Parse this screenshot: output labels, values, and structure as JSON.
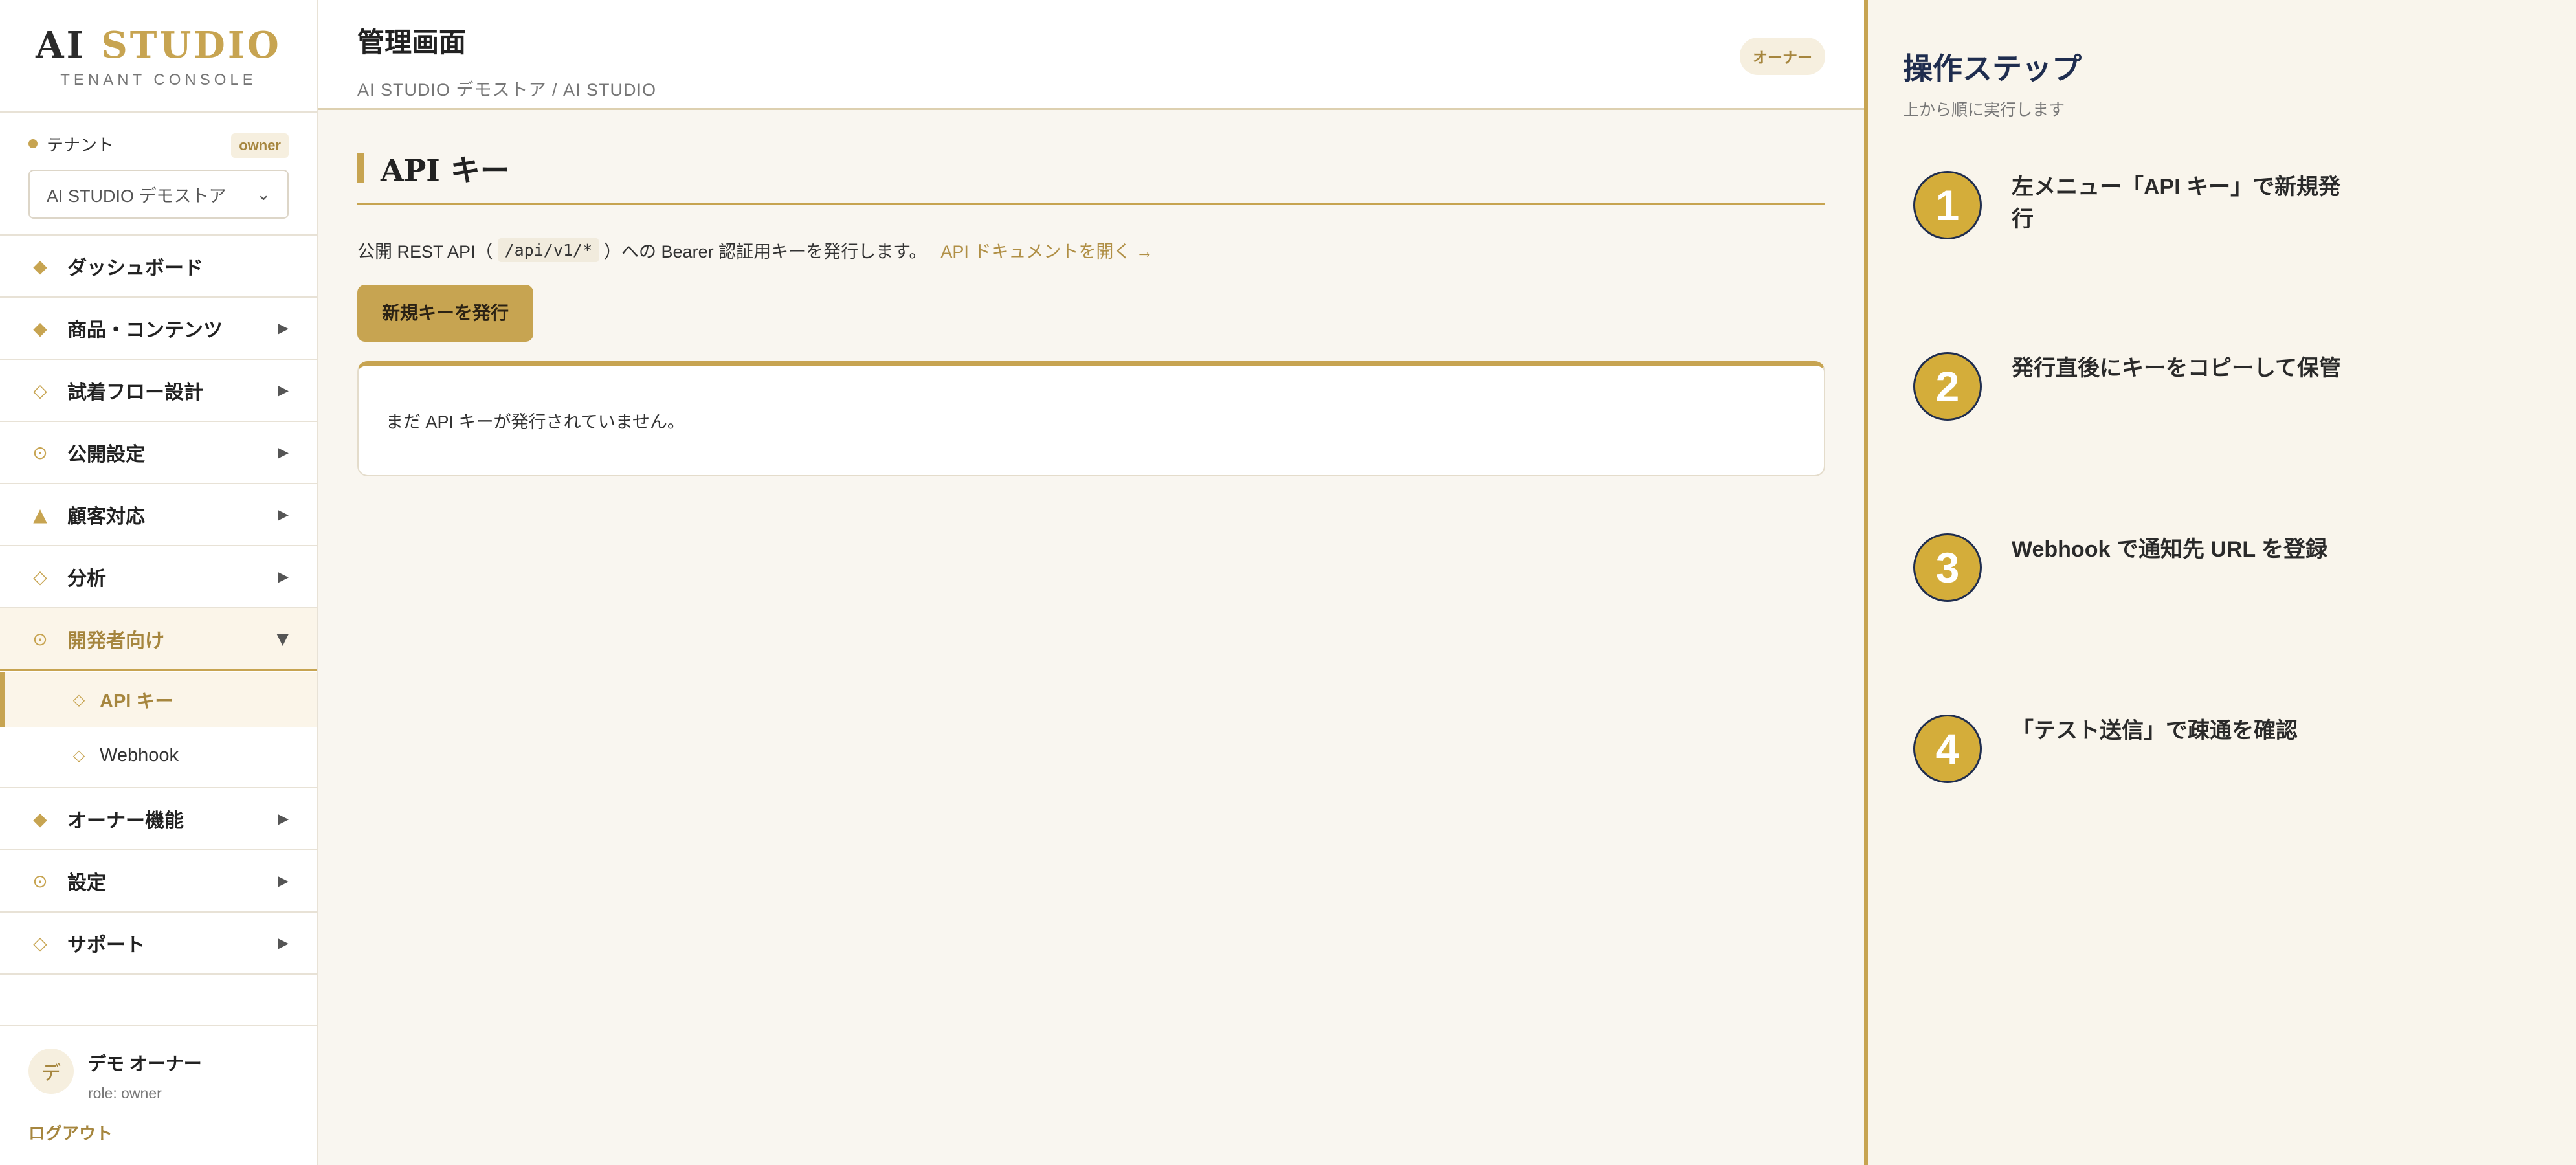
{
  "logo": {
    "title_part1": "AI",
    "title_part2": "STUDIO",
    "subtitle": "TENANT CONSOLE"
  },
  "tenant": {
    "label": "テナント",
    "badge": "owner",
    "selected": "AI STUDIO デモストア"
  },
  "nav": {
    "dashboard": "ダッシュボード",
    "products": "商品・コンテンツ",
    "flow": "試着フロー設計",
    "publish": "公開設定",
    "customer": "顧客対応",
    "analytics": "分析",
    "developer": "開発者向け",
    "developer_sub": {
      "api_keys": "API キー",
      "webhook": "Webhook"
    },
    "owner": "オーナー機能",
    "settings": "設定",
    "support": "サポート"
  },
  "user": {
    "avatar": "デ",
    "name": "デモ オーナー",
    "role": "role: owner",
    "logout": "ログアウト"
  },
  "header": {
    "title": "管理画面",
    "breadcrumb": "AI STUDIO デモストア / AI STUDIO",
    "role_badge": "オーナー"
  },
  "main": {
    "section_title": "API キー",
    "desc_before": "公開 REST API（",
    "desc_code": "/api/v1/*",
    "desc_after": "）への Bearer 認証用キーを発行します。",
    "doc_link": "API ドキュメントを開く →",
    "new_key_button": "新規キーを発行",
    "empty_message": "まだ API キーが発行されていません。"
  },
  "steps": {
    "title": "操作ステップ",
    "subtitle": "上から順に実行します",
    "items": [
      {
        "num": "1",
        "text": "左メニュー「API キー」で新規発行"
      },
      {
        "num": "2",
        "text": "発行直後にキーをコピーして保管"
      },
      {
        "num": "3",
        "text": "Webhook で通知先 URL を登録"
      },
      {
        "num": "4",
        "text": "「テスト送信」で疎通を確認"
      }
    ]
  },
  "colors": {
    "accent": "#c7a451",
    "accent_text": "#a6863e",
    "step_circle": "#d4ad3a",
    "navy": "#1f2d4f",
    "background": "#f9f6f0"
  }
}
